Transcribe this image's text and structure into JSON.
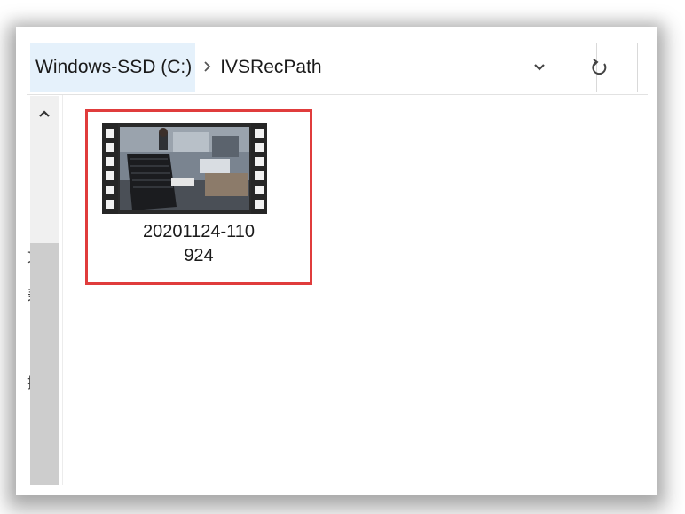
{
  "address_bar": {
    "root_label": "Windows-SSD (C:)",
    "separator": "›",
    "current_folder": "IVSRecPath",
    "dropdown_icon": "chevron-down-icon",
    "refresh_icon": "refresh-icon"
  },
  "nav_pane": {
    "collapse_icon": "chevron-up-icon",
    "partial_glyphs": [
      "文",
      "录",
      "批"
    ]
  },
  "file": {
    "name_line1": "20201124-110",
    "name_line2": "924",
    "thumbnail_icon": "video-file-thumbnail"
  },
  "colors": {
    "highlight_border": "#e03c3c",
    "breadcrumb_hover": "#e5f1fb"
  }
}
